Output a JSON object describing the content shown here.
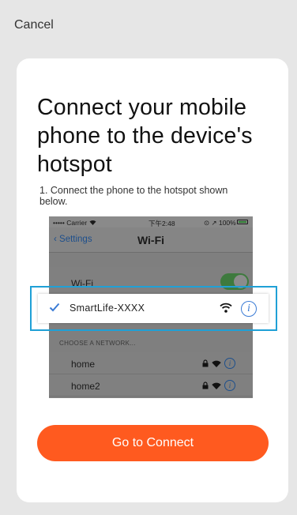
{
  "header": {
    "cancel_label": "Cancel"
  },
  "card": {
    "title": "Connect your mobile phone to the device's hotspot",
    "step_text": "1. Connect the phone to the hotspot shown below."
  },
  "illustration": {
    "status_bar": {
      "carrier": "••••• Carrier ὭC",
      "time": "下午2:48",
      "battery": "⊙ ↗ 100%"
    },
    "nav": {
      "back_label": "‹ Settings",
      "title": "Wi-Fi"
    },
    "wifi_toggle_label": "Wi-Fi",
    "wifi_toggle_on": true,
    "highlighted_network": {
      "name": "SmartLife-XXXX",
      "connected": true
    },
    "section_header": "CHOOSE A NETWORK...",
    "networks": [
      {
        "name": "home"
      },
      {
        "name": "home2"
      }
    ]
  },
  "actions": {
    "connect_label": "Go to Connect"
  },
  "colors": {
    "accent": "#ff5a1f",
    "highlight_border": "#1fa0d6",
    "info_blue": "#3a7bd5"
  }
}
